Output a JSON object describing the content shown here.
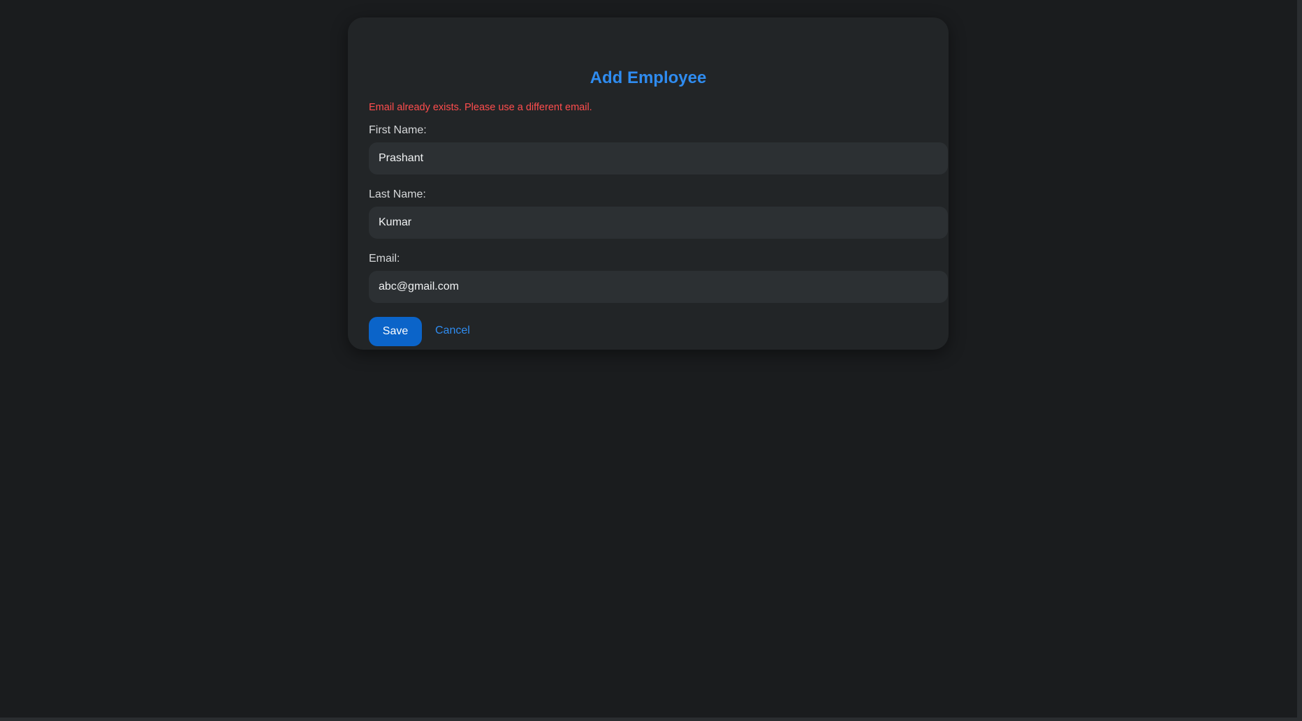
{
  "form": {
    "title": "Add Employee",
    "error_message": "Email already exists. Please use a different email.",
    "fields": [
      {
        "label": "First Name:",
        "value": "Prashant"
      },
      {
        "label": "Last Name:",
        "value": "Kumar"
      },
      {
        "label": "Email:",
        "value": "abc@gmail.com"
      }
    ],
    "save_label": "Save",
    "cancel_label": "Cancel"
  },
  "colors": {
    "background": "#1a1c1e",
    "card": "#222527",
    "accent": "#2f8cf0",
    "button": "#0b64c9",
    "error": "#ff4d4d"
  }
}
